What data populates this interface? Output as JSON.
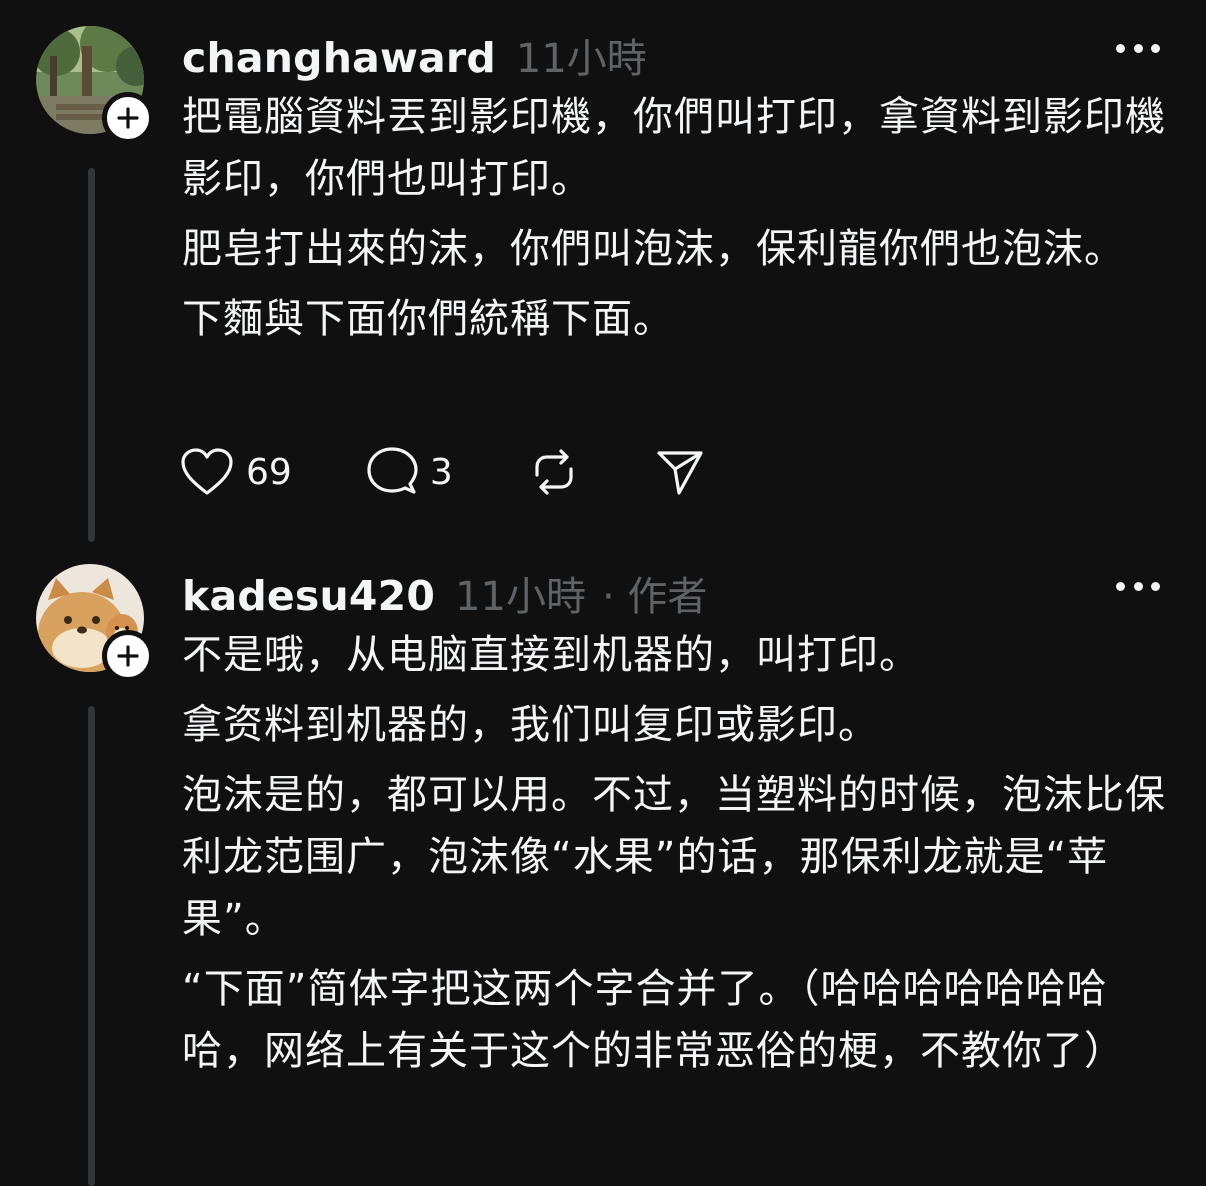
{
  "posts": [
    {
      "username": "changhaward",
      "time": "11小時",
      "author_tag": "",
      "avatar_icon": "tree-park-avatar",
      "follow_icon": "plus-icon",
      "paragraphs": [
        "把電腦資料丟到影印機，你們叫打印，拿資料到影印機影印，你們也叫打印。",
        "肥皂打出來的沫，你們叫泡沫，保利龍你們也泡沫。",
        "下麵與下面你們統稱下面。"
      ],
      "likes": "69",
      "replies": "3"
    },
    {
      "username": "kadesu420",
      "time": "11小時",
      "author_tag": "· 作者",
      "avatar_icon": "shiba-avatar",
      "follow_icon": "plus-icon",
      "paragraphs": [
        "不是哦，从电脑直接到机器的，叫打印。",
        "拿资料到机器的，我们叫复印或影印。",
        "泡沫是的，都可以用。不过，当塑料的时候，泡沫比保利龙范围广，泡沫像“水果”的话，那保利龙就是“苹果”。",
        "“下面”简体字把这两个字合并了。（哈哈哈哈哈哈哈哈，网络上有关于这个的非常恶俗的梗，不教你了）"
      ]
    }
  ],
  "colors": {
    "background": "#101010",
    "text": "#f3f5f7",
    "muted": "#5f6366",
    "thread_line": "#333638"
  }
}
